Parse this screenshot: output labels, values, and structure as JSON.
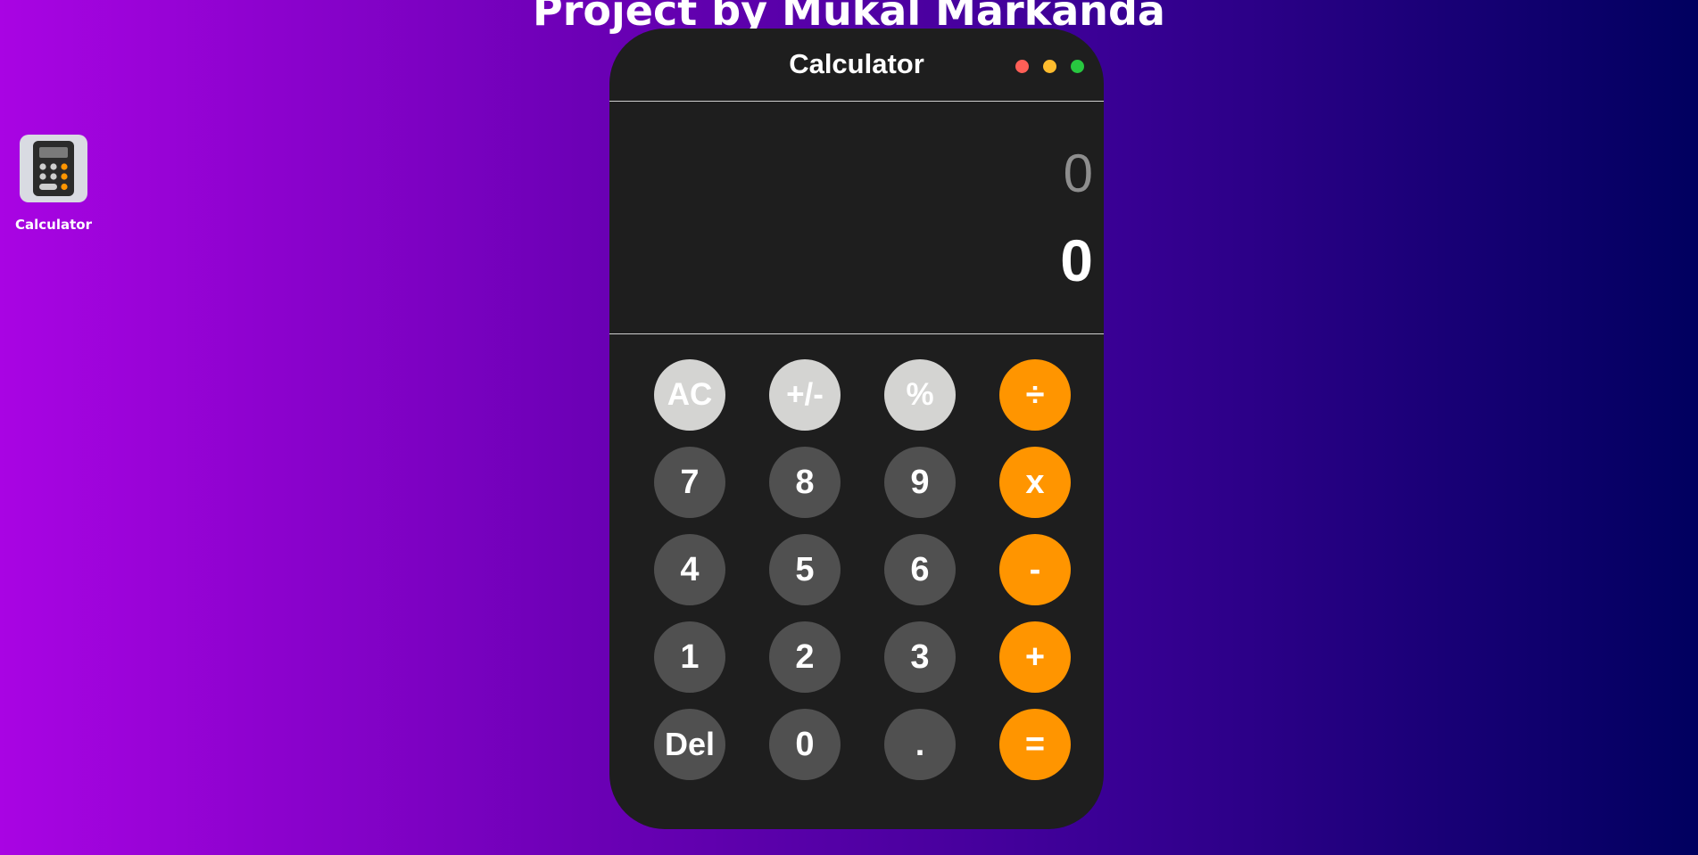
{
  "page": {
    "heading": "Project by Mukal Markanda"
  },
  "desktop": {
    "icon_label": "Calculator"
  },
  "window": {
    "title": "Calculator",
    "controls": {
      "close_color": "#ff5f57",
      "minimize_color": "#febc2e",
      "zoom_color": "#28c840"
    }
  },
  "display": {
    "previous": "0",
    "current": "0"
  },
  "keys": {
    "ac": "AC",
    "sign": "+/-",
    "percent": "%",
    "divide": "÷",
    "seven": "7",
    "eight": "8",
    "nine": "9",
    "multiply": "x",
    "four": "4",
    "five": "5",
    "six": "6",
    "subtract": "-",
    "one": "1",
    "two": "2",
    "three": "3",
    "add": "+",
    "delete": "Del",
    "zero": "0",
    "decimal": ".",
    "equals": "="
  },
  "colors": {
    "accent": "#ff9500",
    "number_key": "#505050",
    "function_key": "#d4d4d2",
    "window_bg": "#1e1e1e"
  }
}
